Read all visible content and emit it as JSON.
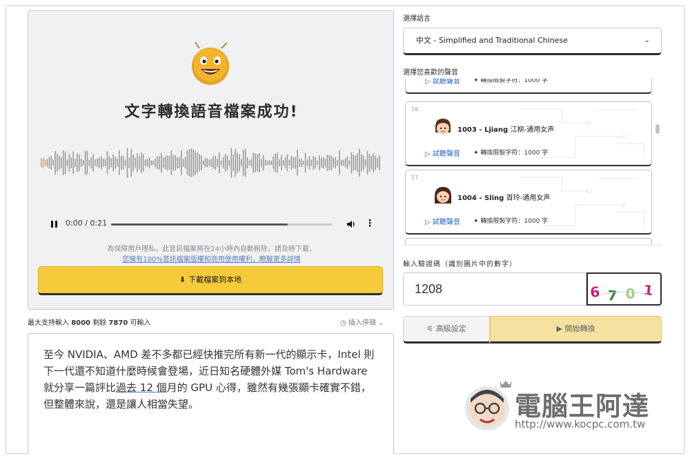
{
  "result": {
    "title": "文字轉換語音檔案成功!",
    "player": {
      "time": "0:00 / 0:21",
      "progress": 0.8
    },
    "privacy_line1": "為保障用戶隱私，此音訊檔案將在24小時內自動刪除，請及時下載，",
    "privacy_line2": "您擁有100%音訊檔案版權和商用使用權利，瞭解更多詳情",
    "download_label": "下載檔案到本地",
    "icons": {
      "play": "pause-icon",
      "volume": "volume-icon",
      "more": "more-vertical-icon",
      "download": "cloud-download-icon"
    }
  },
  "input": {
    "limit_prefix": "最大支持輸入",
    "limit_max": "8000",
    "limit_mid": "剩餘",
    "limit_remaining": "7870",
    "limit_suffix": "可輸入",
    "insert_pause": "插入停頓",
    "text_part1": "至今 NVIDIA、AMD 差不多都已經快推完所有新一代的顯示卡，Intel 則下一代還不知道什麼時候會登場，近日知名硬體外媒 Tom's Hardware 就分享一篇評比",
    "text_underlined": "過去 12 個",
    "text_part2": "月的 GPU 心得，雖然有幾張顯卡確實不錯，但整體來說，還是讓人相當失望。"
  },
  "language": {
    "label": "選擇語言",
    "selected": "中文 - Simplified and Traditional Chinese"
  },
  "voices": {
    "label": "選擇您喜歡的聲音",
    "listen_label": "試聽聲音",
    "limit_label": "轉換限製字符：1000 字",
    "items": [
      {
        "index": "16",
        "code": "1003 - Ljiang",
        "desc": "江柳-通用女声"
      },
      {
        "index": "17",
        "code": "1004 - Sling",
        "desc": "首玲-通用女声"
      }
    ]
  },
  "captcha": {
    "label": "輸入驗證碼（識別圖片中的數字）",
    "value": "1208",
    "digits": [
      {
        "char": "6",
        "color": "#c81e7a"
      },
      {
        "char": "7",
        "color": "#3a8a3a"
      },
      {
        "char": "0",
        "color": "#9ad07a"
      },
      {
        "char": "1",
        "color": "#c81e7a"
      }
    ]
  },
  "actions": {
    "advanced": "高級設定",
    "start": "開始轉換"
  },
  "watermark": {
    "title": "電腦王阿達",
    "url": "http://www.kocpc.com.tw"
  }
}
